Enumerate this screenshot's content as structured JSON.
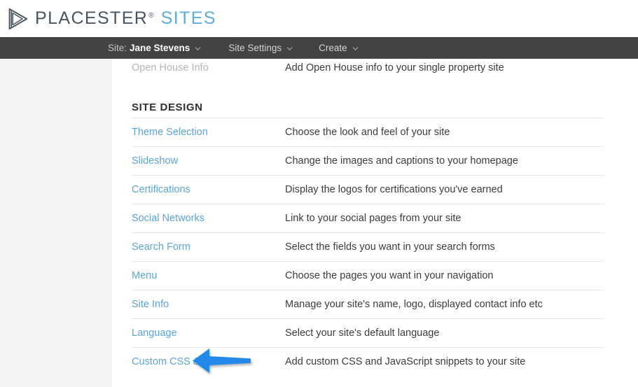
{
  "header": {
    "logo_icon": "placester-play-logo-icon",
    "brand": "PLACESTER",
    "trademark": "®",
    "product": "SITES"
  },
  "navbar": {
    "items": [
      {
        "prefix": "Site:",
        "label": "Jane Stevens",
        "caret": "chevron-down-icon"
      },
      {
        "prefix": "",
        "label": "Site Settings",
        "caret": "chevron-down-icon"
      },
      {
        "prefix": "",
        "label": "Create",
        "caret": "chevron-down-icon"
      }
    ]
  },
  "main": {
    "partial_row": {
      "label": "Open House Info",
      "description": "Add Open House info to your single property site"
    },
    "section_title": "SITE DESIGN",
    "rows": [
      {
        "label": "Theme Selection",
        "description": "Choose the look and feel of your site"
      },
      {
        "label": "Slideshow",
        "description": "Change the images and captions to your homepage"
      },
      {
        "label": "Certifications",
        "description": "Display the logos for certifications you've earned"
      },
      {
        "label": "Social Networks",
        "description": "Link to your social pages from your site"
      },
      {
        "label": "Search Form",
        "description": "Select the fields you want in your search forms"
      },
      {
        "label": "Menu",
        "description": "Choose the pages you want in your navigation"
      },
      {
        "label": "Site Info",
        "description": "Manage your site's name, logo, displayed contact info etc"
      },
      {
        "label": "Language",
        "description": "Select your site's default language"
      },
      {
        "label": "Custom CSS & JS",
        "description": "Add custom CSS and JavaScript snippets to your site"
      }
    ]
  },
  "annotation": {
    "icon": "left-arrow-annotation-icon",
    "color": "#2089e8",
    "points_to": "Site Info"
  },
  "colors": {
    "link": "#5ba4d8",
    "brand_accent": "#5cadd9",
    "navbar_bg": "#434343",
    "page_bg": "#f4f4f4",
    "panel_bg": "#ffffff",
    "arrow": "#2089e8"
  }
}
